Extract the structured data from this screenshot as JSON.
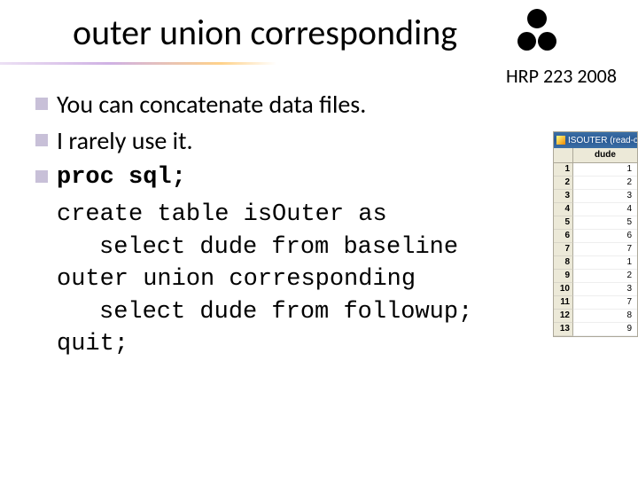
{
  "title": "outer union corresponding",
  "hrp_label": "HRP 223 2008",
  "bullets": {
    "b1": "You can concatenate data files.",
    "b2": "I rarely use it."
  },
  "code": {
    "l1": "proc sql;",
    "l2": "create table isOuter as",
    "l3": "select dude from baseline",
    "l4": "outer union corresponding",
    "l5": "select dude from followup;",
    "l6": "quit;"
  },
  "sas_window": {
    "title": "ISOUTER (read-o",
    "col_header": "dude",
    "rows": [
      {
        "n": "1",
        "v": "1"
      },
      {
        "n": "2",
        "v": "2"
      },
      {
        "n": "3",
        "v": "3"
      },
      {
        "n": "4",
        "v": "4"
      },
      {
        "n": "5",
        "v": "5"
      },
      {
        "n": "6",
        "v": "6"
      },
      {
        "n": "7",
        "v": "7"
      },
      {
        "n": "8",
        "v": "1"
      },
      {
        "n": "9",
        "v": "2"
      },
      {
        "n": "10",
        "v": "3"
      },
      {
        "n": "11",
        "v": "7"
      },
      {
        "n": "12",
        "v": "8"
      },
      {
        "n": "13",
        "v": "9"
      }
    ]
  }
}
